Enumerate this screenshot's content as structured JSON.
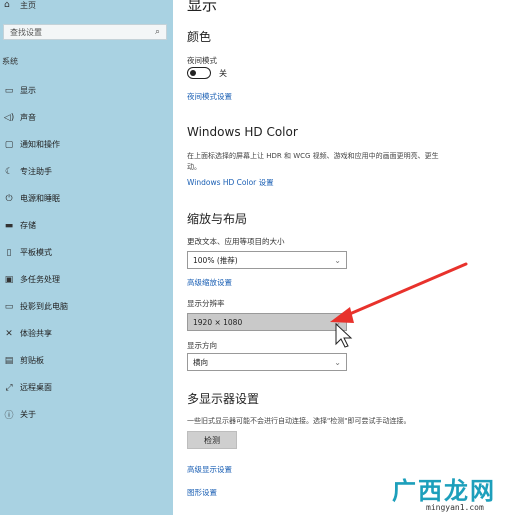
{
  "sidebar": {
    "home_label": "主页",
    "search_placeholder": "查找设置",
    "section_label": "系统",
    "items": [
      {
        "icon": "monitor-icon",
        "label": "显示"
      },
      {
        "icon": "speaker-icon",
        "label": "声音"
      },
      {
        "icon": "notification-icon",
        "label": "通知和操作"
      },
      {
        "icon": "moon-icon",
        "label": "专注助手"
      },
      {
        "icon": "power-icon",
        "label": "电源和睡眠"
      },
      {
        "icon": "storage-icon",
        "label": "存储"
      },
      {
        "icon": "tablet-icon",
        "label": "平板模式"
      },
      {
        "icon": "multitask-icon",
        "label": "多任务处理"
      },
      {
        "icon": "project-icon",
        "label": "投影到此电脑"
      },
      {
        "icon": "shared-experience-icon",
        "label": "体验共享"
      },
      {
        "icon": "clipboard-icon",
        "label": "剪贴板"
      },
      {
        "icon": "remote-desktop-icon",
        "label": "远程桌面"
      },
      {
        "icon": "info-icon",
        "label": "关于"
      }
    ]
  },
  "main": {
    "title": "显示",
    "color": {
      "heading": "颜色",
      "night_light_label": "夜间模式",
      "night_light_state": "关",
      "night_light_link": "夜间模式设置"
    },
    "hd_color": {
      "heading": "Windows HD Color",
      "description": "在上面标选择的屏幕上让 HDR 和 WCG 视频、游戏和应用中的画面更明亮、更生动。",
      "link": "Windows HD Color 设置"
    },
    "scale": {
      "heading": "缩放与布局",
      "size_label": "更改文本、应用等项目的大小",
      "size_value": "100% (推荐)",
      "advanced_link": "高级缩放设置",
      "resolution_label": "显示分辨率",
      "resolution_value": "1920 × 1080",
      "orientation_label": "显示方向",
      "orientation_value": "横向"
    },
    "multi_display": {
      "heading": "多显示器设置",
      "description": "一些旧式显示器可能不会进行自动连接。选择\"检测\"即可尝试手动连接。",
      "detect_button": "检测",
      "advanced_link": "高级显示设置",
      "graphics_link": "图形设置"
    }
  },
  "watermark": {
    "text": "广西龙网",
    "url": "mingyan1.com"
  },
  "colors": {
    "sidebar_bg": "#a9d2e2",
    "link": "#1a5fb4",
    "arrow": "#e8322c"
  }
}
